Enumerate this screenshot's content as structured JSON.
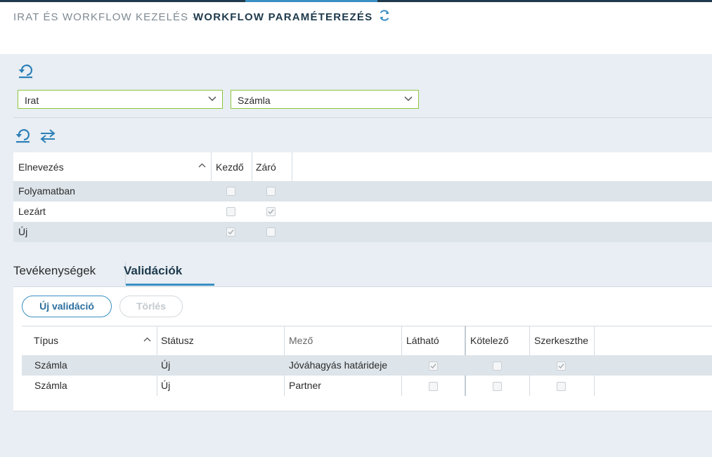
{
  "header": {
    "breadcrumb": "IRAT ÉS WORKFLOW KEZELÉS -",
    "title": "WORKFLOW PARAMÉTEREZÉS"
  },
  "filters": {
    "doc_type": "Irat",
    "sub_type": "Számla"
  },
  "states_table": {
    "columns": [
      "Elnevezés",
      "Kezdő",
      "Záró"
    ],
    "rows": [
      {
        "name": "Folyamatban",
        "start": false,
        "end": false
      },
      {
        "name": "Lezárt",
        "start": false,
        "end": true
      },
      {
        "name": "Új",
        "start": true,
        "end": false
      }
    ]
  },
  "tabs": [
    "Tevékenységek",
    "Validációk"
  ],
  "active_tab": "Validációk",
  "buttons": {
    "new_validation": "Új validáció",
    "delete": "Törlés"
  },
  "validations_table": {
    "columns": [
      "Típus",
      "Státusz",
      "Mező",
      "Látható",
      "Kötelező",
      "Szerkeszthe"
    ],
    "rows": [
      {
        "type": "Számla",
        "status": "Új",
        "field": "Jóváhagyás határideje",
        "visible": true,
        "required": false,
        "editable": true
      },
      {
        "type": "Számla",
        "status": "Új",
        "field": "Partner",
        "visible": false,
        "required": false,
        "editable": false
      }
    ]
  },
  "colors": {
    "accent": "#3a8fc4",
    "dark": "#1e3a4c",
    "select_border": "#8cc63f"
  }
}
